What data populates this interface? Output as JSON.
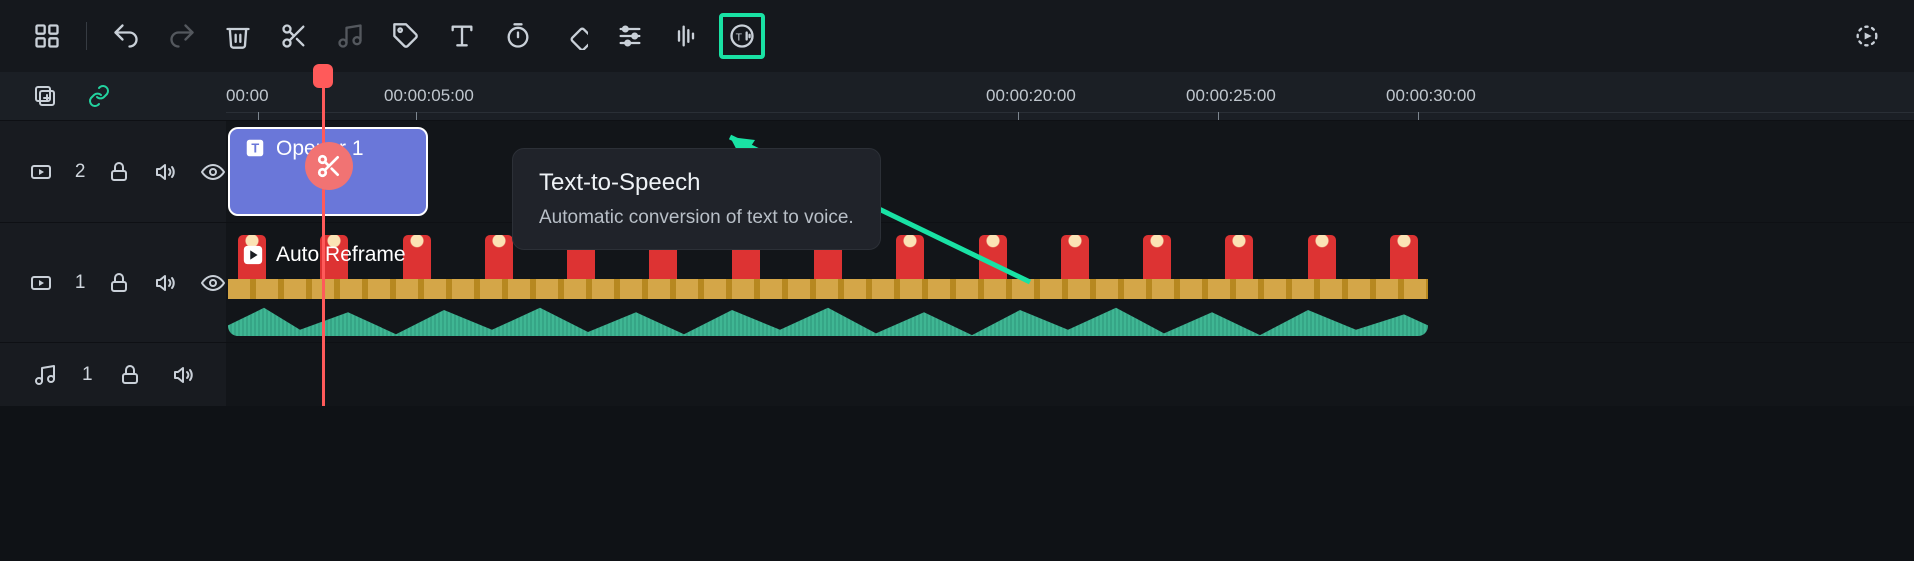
{
  "toolbar": {
    "icons": [
      "apps-icon",
      "sep",
      "undo-icon",
      "redo-icon",
      "trash-icon",
      "scissors-icon",
      "note-icon",
      "tag-icon",
      "text-icon",
      "timer-icon",
      "keyframe-icon",
      "sliders-icon",
      "audio-settings-icon",
      "tts-icon",
      "render-queue-icon"
    ],
    "highlighted": "tts-icon"
  },
  "tooltip": {
    "title": "Text-to-Speech",
    "body": "Automatic conversion of text to voice."
  },
  "ruler": {
    "labels": [
      {
        "pos": 0,
        "text": "00:00"
      },
      {
        "pos": 200,
        "text": "00:00:05:00"
      },
      {
        "pos": 780,
        "text": "00:00:20:00"
      },
      {
        "pos": 980,
        "text": "00:00:25:00"
      },
      {
        "pos": 1180,
        "text": "00:00:30:00"
      }
    ]
  },
  "track_header": {
    "add_label": "",
    "link_label": "",
    "video2": {
      "label": "2"
    },
    "video1": {
      "label": "1"
    },
    "audio1": {
      "label": "1"
    }
  },
  "clips": {
    "opener": {
      "label": "Opener 1"
    },
    "auto_reframe": {
      "label": "Auto Reframe"
    }
  },
  "cut_badge": {
    "icon": "scissors"
  }
}
